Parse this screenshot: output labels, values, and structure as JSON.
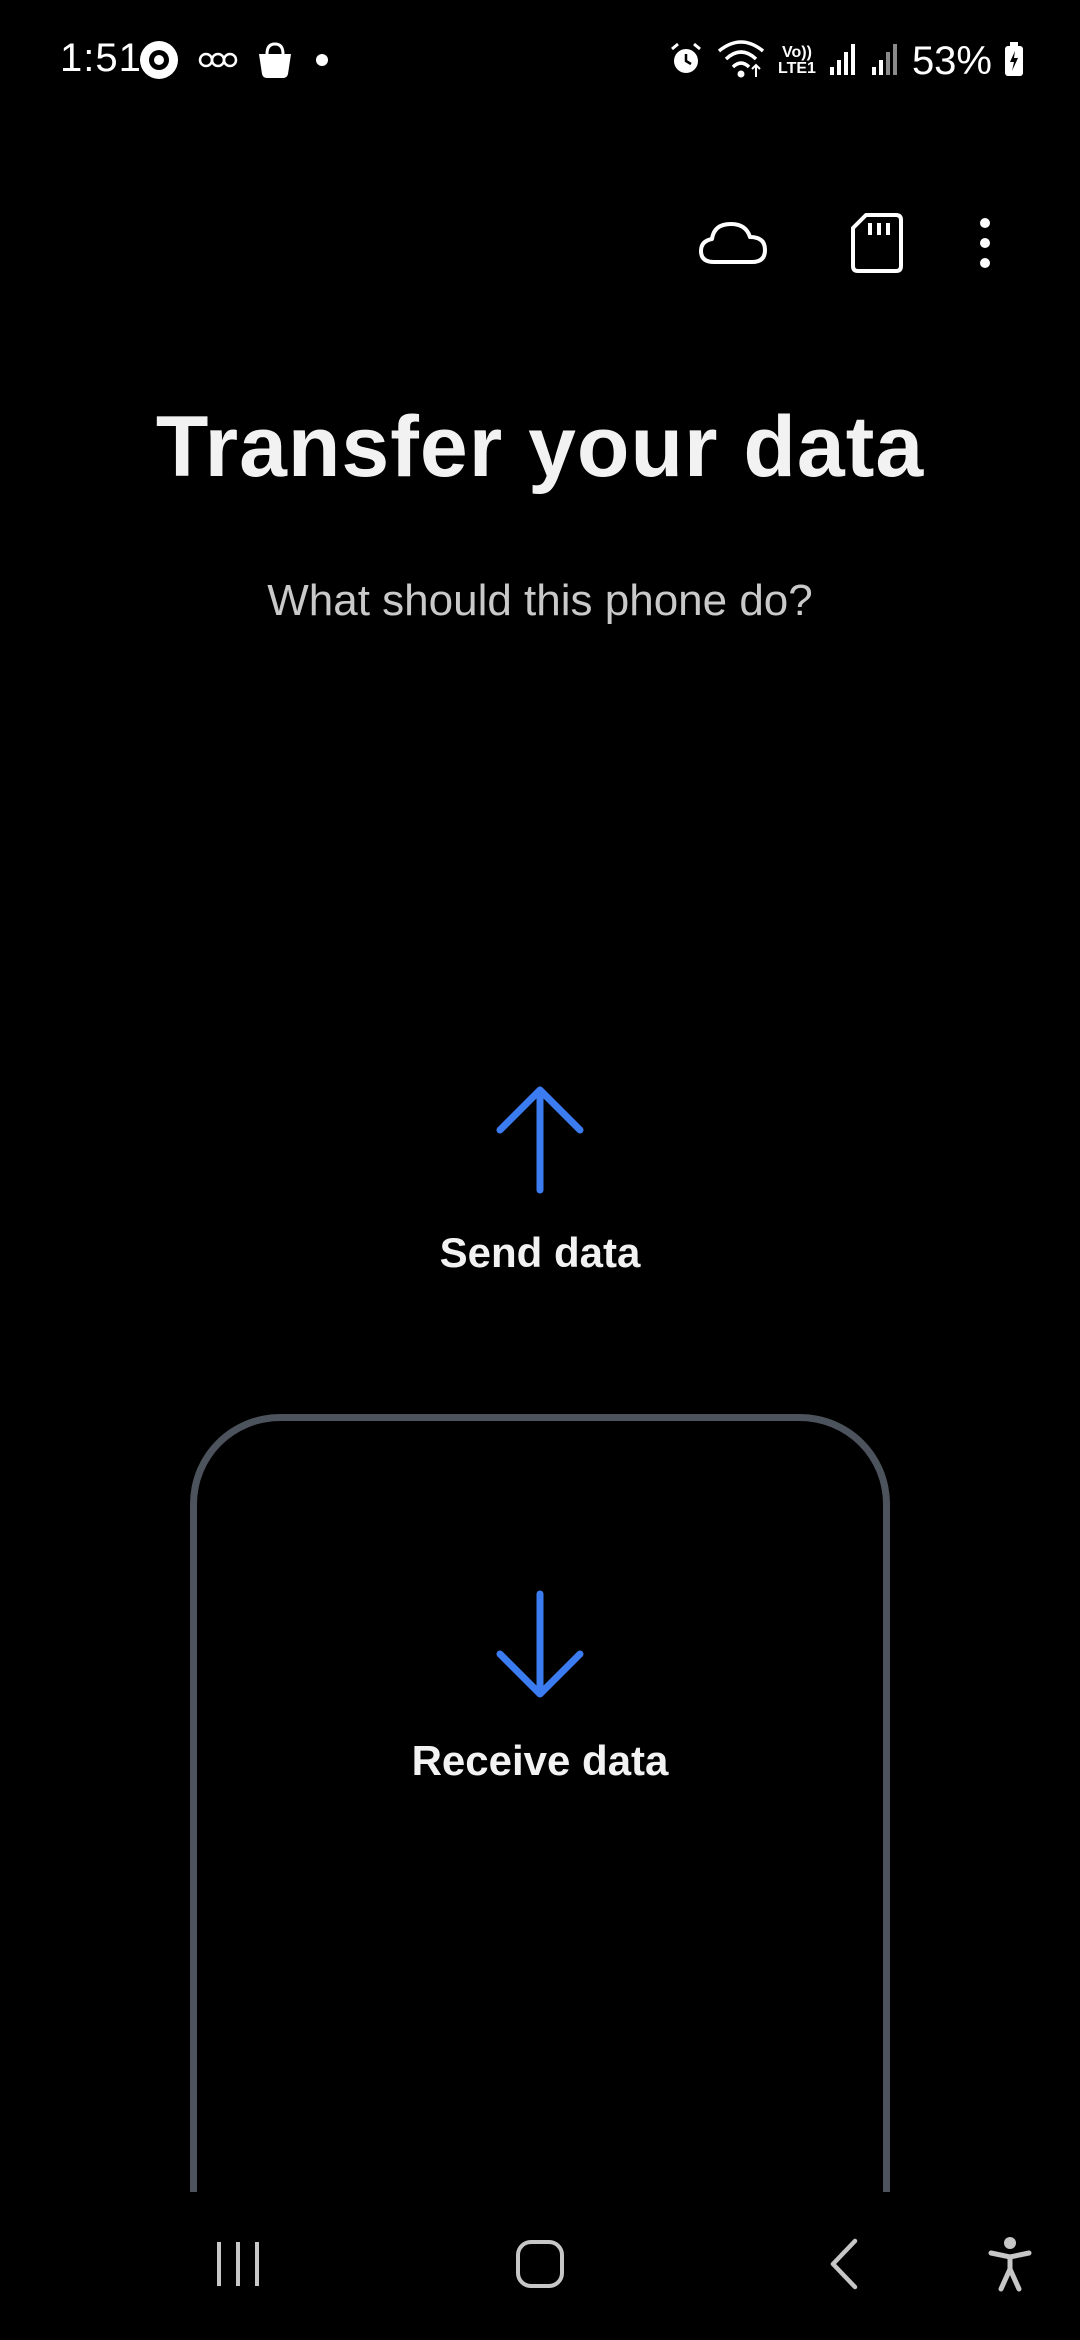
{
  "status_bar": {
    "time": "1:51",
    "battery": "53%",
    "icons_left": [
      "target-app-icon",
      "voicemail-icon",
      "shopping-bag-icon",
      "dot-notification-icon"
    ],
    "icons_right": [
      "alarm-icon",
      "wifi-icon",
      "volte-icon",
      "signal-strength-icon",
      "signal-strength-icon-2",
      "battery-charging-icon"
    ],
    "volte_label_top": "Vo))",
    "volte_label_bottom": "LTE1"
  },
  "top_actions": {
    "icons": [
      "cloud-icon",
      "sd-card-icon",
      "more-options-icon"
    ]
  },
  "title": "Transfer your data",
  "subtitle": "What should this phone do?",
  "options": {
    "send_label": "Send data",
    "receive_label": "Receive data"
  },
  "colors": {
    "accent": "#3b7cf0",
    "background": "#000000",
    "outline": "#4d535c",
    "text": "#f2f2f2",
    "subtext": "#c9c9c9"
  },
  "nav_bar": {
    "icons": [
      "recent-apps-icon",
      "home-icon",
      "back-icon",
      "accessibility-icon"
    ]
  }
}
